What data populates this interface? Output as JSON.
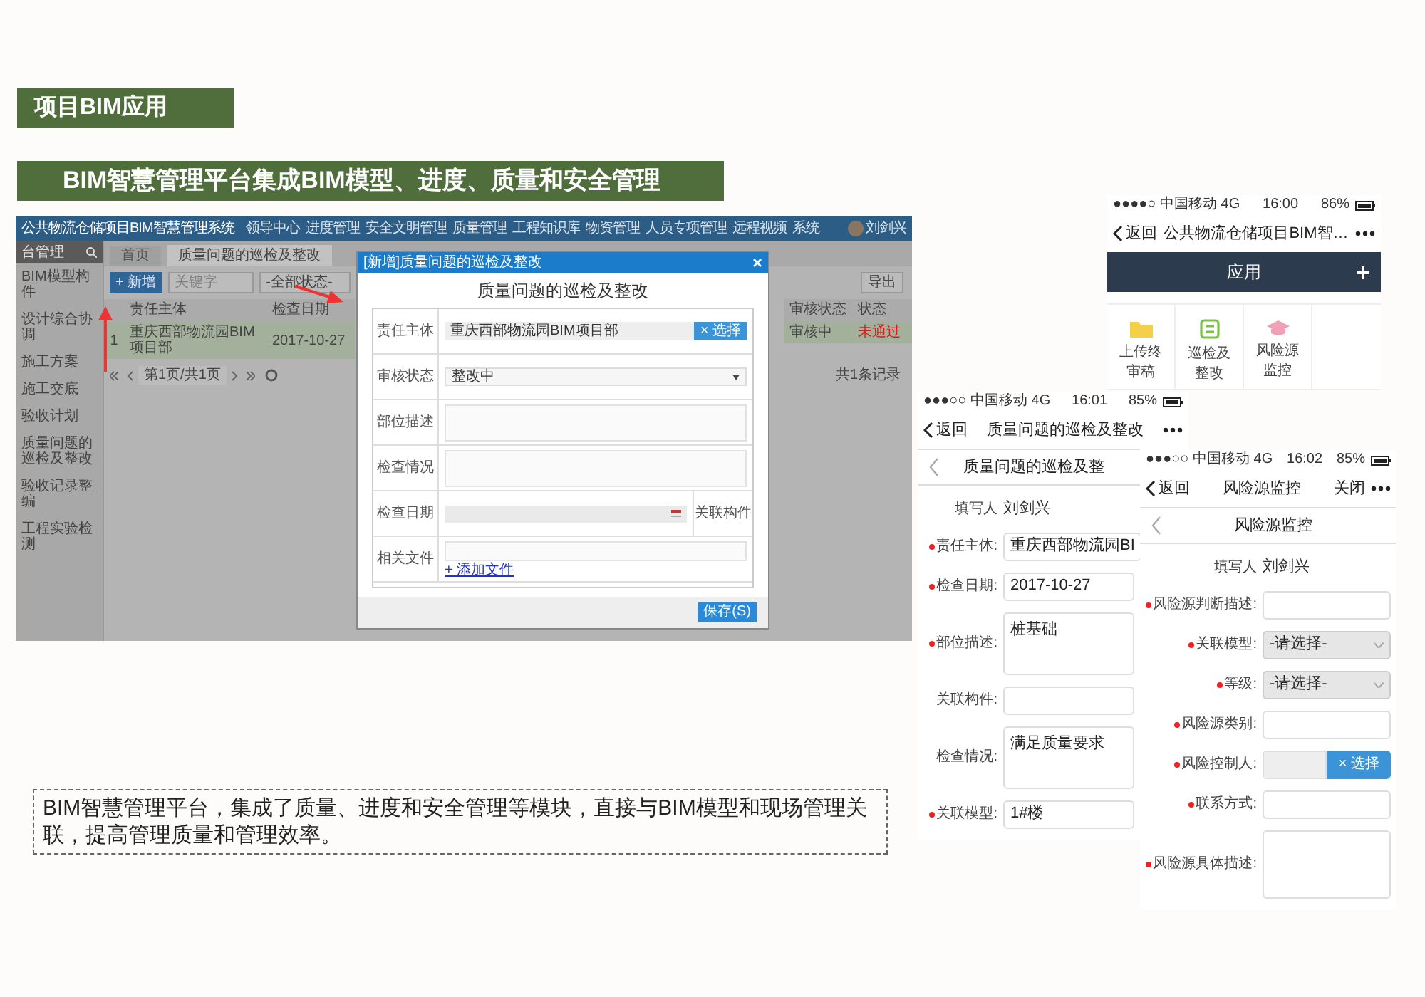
{
  "section_title": "项目BIM应用",
  "headline": "BIM智慧管理平台集成BIM模型、进度、质量和安全管理",
  "desktop": {
    "app_title": "公共物流仓储项目BIM智慧管理系统",
    "nav": [
      "领导中心",
      "进度管理",
      "安全文明管理",
      "质量管理",
      "工程知识库",
      "物资管理",
      "人员专项管理",
      "远程视频",
      "系统"
    ],
    "user": "刘剑兴",
    "sidebar_title": "台管理",
    "sidebar": [
      "BIM模型构件",
      "设计综合协调",
      "施工方案",
      "施工交底",
      "验收计划",
      "质量问题的巡检及整改",
      "验收记录整编",
      "工程实验检测"
    ],
    "tabs": [
      {
        "label": "首页",
        "selected": false
      },
      {
        "label": "质量问题的巡检及整改",
        "selected": true
      }
    ],
    "toolbar": {
      "add": "+ 新增",
      "search_placeholder": "关键字",
      "status": "-全部状态-",
      "export": "导出"
    },
    "table_left": {
      "columns": [
        "",
        "责任主体",
        "检查日期"
      ],
      "rows": [
        [
          "1",
          "重庆西部物流园BIM项目部",
          "2017-10-27"
        ]
      ]
    },
    "table_right": {
      "columns": [
        "审核状态",
        "状态"
      ],
      "rows": [
        [
          "审核中",
          "未通过"
        ]
      ]
    },
    "pager": "第1页/共1页",
    "record_info": "共1条记录",
    "dialog": {
      "title": "[新增]质量问题的巡检及整改",
      "heading": "质量问题的巡检及整改",
      "fields": [
        {
          "kind": "picker",
          "label": "责任主体",
          "value": "重庆西部物流园BIM项目部",
          "button": "× 选择"
        },
        {
          "kind": "select",
          "label": "审核状态",
          "value": "整改中"
        },
        {
          "kind": "textarea",
          "label": "部位描述"
        },
        {
          "kind": "textarea",
          "label": "检查情况"
        },
        {
          "kind": "date",
          "label": "检查日期",
          "side_label": "关联构件"
        },
        {
          "kind": "files",
          "label": "相关文件",
          "link": "+ 添加文件"
        }
      ],
      "save": "保存(S)"
    }
  },
  "phones": [
    {
      "kind": "menu",
      "signal": "●●●●○ 中国移动 4G",
      "time": "16:00",
      "battery": "86%",
      "back": "返回",
      "title": "公共物流仓储项目BIM智…",
      "bar": "应用",
      "tiles": [
        {
          "kind": "folder",
          "label": "上传终审稿"
        },
        {
          "kind": "checklist",
          "label": "巡检及整改"
        },
        {
          "kind": "hat",
          "label": "风险源监控"
        }
      ]
    },
    {
      "kind": "form",
      "signal": "●●●○○ 中国移动 4G",
      "time": "16:01",
      "battery": "85%",
      "back": "返回",
      "title": "质量问题的巡检及整改",
      "subtitle": "质量问题的巡检及整",
      "fields": [
        {
          "kind": "text",
          "label": "填写人",
          "value": "刘剑兴"
        },
        {
          "kind": "input",
          "label": "责任主体:",
          "value": "重庆西部物流园BI",
          "required": true
        },
        {
          "kind": "input",
          "label": "检查日期:",
          "value": "2017-10-27",
          "required": true
        },
        {
          "kind": "textarea",
          "label": "部位描述:",
          "value": "桩基础",
          "required": true
        },
        {
          "kind": "input",
          "label": "关联构件:"
        },
        {
          "kind": "textarea",
          "label": "检查情况:",
          "value": "满足质量要求"
        },
        {
          "kind": "input",
          "label": "关联模型:",
          "value": "1#楼",
          "required": true
        }
      ]
    },
    {
      "kind": "form",
      "signal": "●●●○○ 中国移动 4G",
      "time": "16:02",
      "battery": "85%",
      "back": "返回",
      "title": "风险源监控",
      "close": "关闭",
      "subtitle": "风险源监控",
      "fields": [
        {
          "kind": "text",
          "label": "填写人",
          "value": "刘剑兴"
        },
        {
          "kind": "input",
          "label": "风险源判断描述:",
          "required": true
        },
        {
          "kind": "select",
          "label": "关联模型:",
          "value": "-请选择-",
          "required": true
        },
        {
          "kind": "select",
          "label": "等级:",
          "value": "-请选择-",
          "required": true
        },
        {
          "kind": "input",
          "label": "风险源类别:",
          "required": true
        },
        {
          "kind": "picker",
          "label": "风险控制人:",
          "button": "× 选择",
          "required": true
        },
        {
          "kind": "input",
          "label": "联系方式:",
          "required": true
        },
        {
          "kind": "textarea",
          "label": "风险源具体描述:",
          "required": true
        }
      ]
    }
  ],
  "caption": "BIM智慧管理平台，集成了质量、进度和安全管理等模块，直接与BIM模型和现场管理关联，提高管理质量和管理效率。"
}
